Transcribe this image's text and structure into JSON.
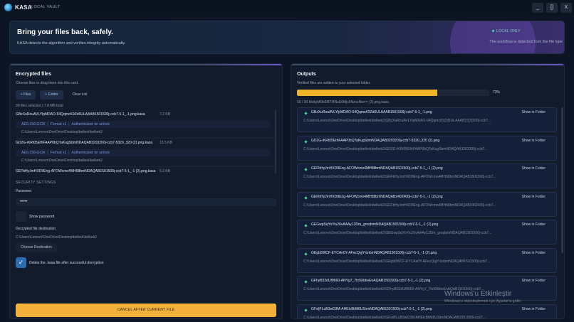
{
  "app": {
    "name": "KASA",
    "subtitle": "LOCAL VAULT"
  },
  "window_controls": {
    "minimize": "_",
    "maximize": "[]",
    "close": "X"
  },
  "hero": {
    "title": "Bring your files back, safely.",
    "subtitle": "KASA detects the algorithm and verifies integrity automatically.",
    "badge": "LOCAL ONLY",
    "note": "The workflow is detected from the file type"
  },
  "encrypted": {
    "title": "Encrypted files",
    "subtitle": "Choose files or drag them into this card.",
    "add_files": "+ Files",
    "add_folder": "+ Folder",
    "clear_list": "Clear List",
    "counts": "90 files selected  |  7.8 MB total",
    "files": [
      {
        "name": "GBzXuRouAVLYlpMDAO-64QqmcK9Zd6ULAAAB1501500j-ccb7-5-1_-1.png.kasa",
        "size": "7.2 KB",
        "algorithm": "AES-256-GCM",
        "format": "Format v1",
        "status": "Authenticated on unlock",
        "path": "C:\\Users\\Lenovo\\OneDrive\\Desktop\\belkek\\belkek2"
      },
      {
        "name": "GD2G-iKRt05EthFAAP0bQTaKugSbmNDAQAB3203200j-ccb7-5320_320 (2).png.kasa",
        "size": "15.5 KB",
        "algorithm": "AES-256-GCM",
        "format": "Format v1",
        "status": "Authenticated on unlock",
        "path": "C:\\Users\\Lenovo\\OneDrive\\Desktop\\belkek\\belkek2"
      },
      {
        "name": "GEFbHyJmHXD9Eng-AFOWcmo4MH58bmNDAQAB1501500j-ccb7-5-1_-1 (2).png.kasa",
        "size": "5.2 KB",
        "algorithm": "",
        "format": "",
        "status": "",
        "path": ""
      }
    ],
    "security_label": "SECURITY SETTINGS",
    "password_label": "Password",
    "password_value": "•••••",
    "show_password": "Show password",
    "destination_label": "Decrypted file destination",
    "destination_path": "C:\\Users\\Lenovo\\OneDrive\\Desktop\\belkek\\belkek2",
    "choose_destination": "Choose Destination",
    "delete_label": "Delete the .kasa file after successful decryption",
    "delete_checked": true,
    "cancel": "CANCEL AFTER CURRENT FILE"
  },
  "outputs": {
    "title": "Outputs",
    "subtitle": "Verified files are written to your selected folder.",
    "progress": 0.73,
    "progress_text": "73%",
    "progress_file": "66 / 90   MzkyMDk0MTI4NzE0Mjc5NzczNw== (2).png.kasa",
    "show_label": "Show in Folder",
    "items": [
      {
        "name": "GBzXuRouAVLYlpMDAO-64QqmcK9Zd6ULAAAB1501500j-ccb7-5-1_-1.png",
        "path": "C:\\Users\\Lenovo\\OneDrive\\Desktop\\belkek\\belkek2\\GBzXuRouAVLYlpMDAO-64QqmcK9Zd6ULAAAB1501500j-ccb7..."
      },
      {
        "name": "GD2G-iKRt05EthFAAP0bQTaKugSbmNDAQAB3203200j-ccb7-5320_320 (2).png",
        "path": "C:\\Users\\Lenovo\\OneDrive\\Desktop\\belkek\\belkek2\\GD2G-iKRt05EthFAAP0bQTaKugSbmNDAQAB3203200j-ccb7..."
      },
      {
        "name": "GEFbHyJmHXD9Eng-AFOWcmo4MH58bmNDAQAB1501500j-ccb7-5-1_-1 (2).png",
        "path": "C:\\Users\\Lenovo\\OneDrive\\Desktop\\belkek\\belkek2\\GEFbHyJmHXD9Eng-AFOWcmo4MH58bmNDAQAB1501500j-ccb7..."
      },
      {
        "name": "GEFbHyJmHXD9Eng-AFOWcmo4MH58bmNDAQAB2402400j-ccb7-5-1_-1 (2).png",
        "path": "C:\\Users\\Lenovo\\OneDrive\\Desktop\\belkek\\belkek2\\GEFbHyJmHXD9Eng-AFOWcmo4MH58bmNDAQAB2402400j-ccb7..."
      },
      {
        "name": "GEGwpSqYoYiu26vAAAy12Dm_groqbimNDAQAB1501500j-ccb7-5-1_-1 (2).png",
        "path": "C:\\Users\\Lenovo\\OneDrive\\Desktop\\belkek\\belkek2\\GEGwpSqYoYiu26vAAAy12Dm_groqbimNDAQAB1501500j-ccb7..."
      },
      {
        "name": "GEgb0WCF-EYCAn0Y-AFecQqjY-bnbmNDAQAB1501500j-ccb7-5-1_-1 (2).png",
        "path": "C:\\Users\\Lenovo\\OneDrive\\Desktop\\belkek\\belkek2\\GEgb0WCF-EYCAn0Y-AFecQqjY-bnbmNDAQAB1501500j-ccb7..."
      },
      {
        "name": "GFhyB32dUf9660-ANYg7_7tx9XbbvEnAQAB1501500j-ccb7-5-1_-1 (2).png",
        "path": "C:\\Users\\Lenovo\\OneDrive\\Desktop\\belkek\\belkek2\\GFhyB32dUf9660-ANYg7_7tx9XbbvEnAQAB1501500j-ccb7..."
      },
      {
        "name": "GFsljFLuB3wD3M-AHEIc8bM6U1bmNDAQAB1501500j-ccb7-5-1_-1 (2).png",
        "path": "C:\\Users\\Lenovo\\OneDrive\\Desktop\\belkek\\belkek2\\GFsljFLuB3wD3M-AHEIc8bM6U1bmNDAQAB1501500j-ccb7..."
      }
    ]
  },
  "watermark": {
    "line1": "Windows'u Etkinleştir",
    "line2": "Windows'u etkinleştirmek için Ayarlar'a gidin."
  }
}
